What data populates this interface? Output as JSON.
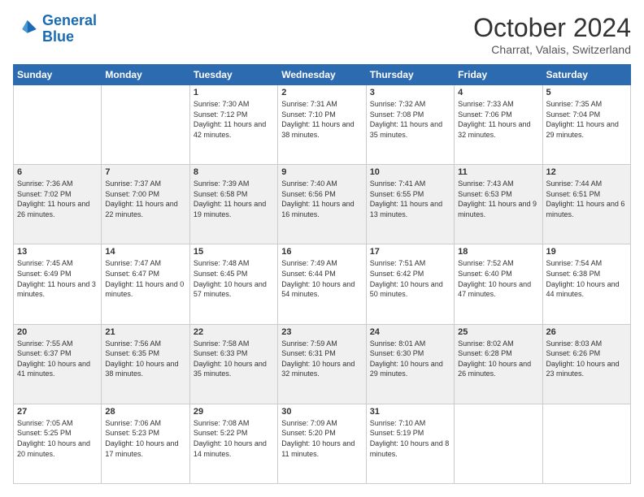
{
  "header": {
    "logo_line1": "General",
    "logo_line2": "Blue",
    "month": "October 2024",
    "location": "Charrat, Valais, Switzerland"
  },
  "weekdays": [
    "Sunday",
    "Monday",
    "Tuesday",
    "Wednesday",
    "Thursday",
    "Friday",
    "Saturday"
  ],
  "weeks": [
    [
      {
        "day": "",
        "content": ""
      },
      {
        "day": "",
        "content": ""
      },
      {
        "day": "1",
        "content": "Sunrise: 7:30 AM\nSunset: 7:12 PM\nDaylight: 11 hours and 42 minutes."
      },
      {
        "day": "2",
        "content": "Sunrise: 7:31 AM\nSunset: 7:10 PM\nDaylight: 11 hours and 38 minutes."
      },
      {
        "day": "3",
        "content": "Sunrise: 7:32 AM\nSunset: 7:08 PM\nDaylight: 11 hours and 35 minutes."
      },
      {
        "day": "4",
        "content": "Sunrise: 7:33 AM\nSunset: 7:06 PM\nDaylight: 11 hours and 32 minutes."
      },
      {
        "day": "5",
        "content": "Sunrise: 7:35 AM\nSunset: 7:04 PM\nDaylight: 11 hours and 29 minutes."
      }
    ],
    [
      {
        "day": "6",
        "content": "Sunrise: 7:36 AM\nSunset: 7:02 PM\nDaylight: 11 hours and 26 minutes."
      },
      {
        "day": "7",
        "content": "Sunrise: 7:37 AM\nSunset: 7:00 PM\nDaylight: 11 hours and 22 minutes."
      },
      {
        "day": "8",
        "content": "Sunrise: 7:39 AM\nSunset: 6:58 PM\nDaylight: 11 hours and 19 minutes."
      },
      {
        "day": "9",
        "content": "Sunrise: 7:40 AM\nSunset: 6:56 PM\nDaylight: 11 hours and 16 minutes."
      },
      {
        "day": "10",
        "content": "Sunrise: 7:41 AM\nSunset: 6:55 PM\nDaylight: 11 hours and 13 minutes."
      },
      {
        "day": "11",
        "content": "Sunrise: 7:43 AM\nSunset: 6:53 PM\nDaylight: 11 hours and 9 minutes."
      },
      {
        "day": "12",
        "content": "Sunrise: 7:44 AM\nSunset: 6:51 PM\nDaylight: 11 hours and 6 minutes."
      }
    ],
    [
      {
        "day": "13",
        "content": "Sunrise: 7:45 AM\nSunset: 6:49 PM\nDaylight: 11 hours and 3 minutes."
      },
      {
        "day": "14",
        "content": "Sunrise: 7:47 AM\nSunset: 6:47 PM\nDaylight: 11 hours and 0 minutes."
      },
      {
        "day": "15",
        "content": "Sunrise: 7:48 AM\nSunset: 6:45 PM\nDaylight: 10 hours and 57 minutes."
      },
      {
        "day": "16",
        "content": "Sunrise: 7:49 AM\nSunset: 6:44 PM\nDaylight: 10 hours and 54 minutes."
      },
      {
        "day": "17",
        "content": "Sunrise: 7:51 AM\nSunset: 6:42 PM\nDaylight: 10 hours and 50 minutes."
      },
      {
        "day": "18",
        "content": "Sunrise: 7:52 AM\nSunset: 6:40 PM\nDaylight: 10 hours and 47 minutes."
      },
      {
        "day": "19",
        "content": "Sunrise: 7:54 AM\nSunset: 6:38 PM\nDaylight: 10 hours and 44 minutes."
      }
    ],
    [
      {
        "day": "20",
        "content": "Sunrise: 7:55 AM\nSunset: 6:37 PM\nDaylight: 10 hours and 41 minutes."
      },
      {
        "day": "21",
        "content": "Sunrise: 7:56 AM\nSunset: 6:35 PM\nDaylight: 10 hours and 38 minutes."
      },
      {
        "day": "22",
        "content": "Sunrise: 7:58 AM\nSunset: 6:33 PM\nDaylight: 10 hours and 35 minutes."
      },
      {
        "day": "23",
        "content": "Sunrise: 7:59 AM\nSunset: 6:31 PM\nDaylight: 10 hours and 32 minutes."
      },
      {
        "day": "24",
        "content": "Sunrise: 8:01 AM\nSunset: 6:30 PM\nDaylight: 10 hours and 29 minutes."
      },
      {
        "day": "25",
        "content": "Sunrise: 8:02 AM\nSunset: 6:28 PM\nDaylight: 10 hours and 26 minutes."
      },
      {
        "day": "26",
        "content": "Sunrise: 8:03 AM\nSunset: 6:26 PM\nDaylight: 10 hours and 23 minutes."
      }
    ],
    [
      {
        "day": "27",
        "content": "Sunrise: 7:05 AM\nSunset: 5:25 PM\nDaylight: 10 hours and 20 minutes."
      },
      {
        "day": "28",
        "content": "Sunrise: 7:06 AM\nSunset: 5:23 PM\nDaylight: 10 hours and 17 minutes."
      },
      {
        "day": "29",
        "content": "Sunrise: 7:08 AM\nSunset: 5:22 PM\nDaylight: 10 hours and 14 minutes."
      },
      {
        "day": "30",
        "content": "Sunrise: 7:09 AM\nSunset: 5:20 PM\nDaylight: 10 hours and 11 minutes."
      },
      {
        "day": "31",
        "content": "Sunrise: 7:10 AM\nSunset: 5:19 PM\nDaylight: 10 hours and 8 minutes."
      },
      {
        "day": "",
        "content": ""
      },
      {
        "day": "",
        "content": ""
      }
    ]
  ]
}
